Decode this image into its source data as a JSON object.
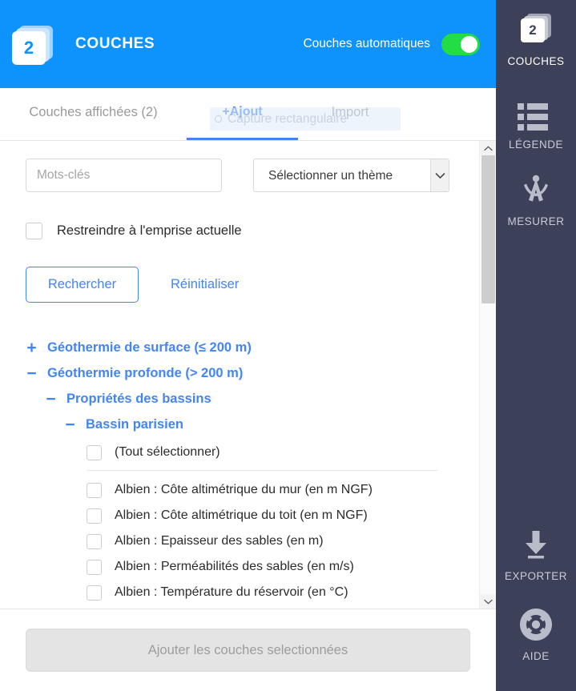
{
  "header": {
    "badge_count": "2",
    "title": "COUCHES",
    "auto_layers_label": "Couches automatiques",
    "toggle_state": "on",
    "bg_color": "#0d93fb",
    "toggle_color": "#22dd44"
  },
  "tabs": [
    {
      "id": "displayed",
      "label": "Couches affichées (2)",
      "active": false
    },
    {
      "id": "add",
      "label": "+Ajout",
      "active": true
    },
    {
      "id": "import",
      "label": "Import",
      "active": false
    }
  ],
  "overlay": {
    "capture_label": "Capture rectangulaire"
  },
  "search": {
    "keywords_placeholder": "Mots-clés",
    "keywords_value": "",
    "theme_selected": "Sélectionner un thème",
    "theme_options": [
      "Sélectionner un thème"
    ],
    "restrict_label": "Restreindre à l'emprise actuelle",
    "restrict_checked": false,
    "search_button": "Rechercher",
    "reset_button": "Réinitialiser",
    "accent_color": "#4285f4"
  },
  "tree": [
    {
      "level": 1,
      "toggle": "+",
      "label": "Géothermie de surface (≤ 200 m)",
      "expanded": false
    },
    {
      "level": 1,
      "toggle": "−",
      "label": "Géothermie profonde (> 200 m)",
      "expanded": true
    },
    {
      "level": 2,
      "toggle": "−",
      "label": "Propriétés des bassins",
      "expanded": true
    },
    {
      "level": 3,
      "toggle": "−",
      "label": "Bassin parisien",
      "expanded": true
    }
  ],
  "leaves": {
    "select_all_label": "(Tout sélectionner)",
    "items": [
      {
        "label": "Albien : Côte altimétrique du mur (en m NGF)",
        "checked": false
      },
      {
        "label": "Albien : Côte altimétrique du toit (en m NGF)",
        "checked": false
      },
      {
        "label": "Albien : Epaisseur des sables (en m)",
        "checked": false
      },
      {
        "label": "Albien : Perméabilités des sables (en m/s)",
        "checked": false
      },
      {
        "label": "Albien : Température du réservoir (en °C)",
        "checked": false
      }
    ]
  },
  "footer": {
    "add_button": "Ajouter les couches selectionnées",
    "add_button_disabled": true
  },
  "rail": {
    "bg_color": "#3c4159",
    "items": [
      {
        "id": "couches",
        "label": "COUCHES",
        "icon": "layers-icon",
        "badge": "2",
        "active": true
      },
      {
        "id": "legende",
        "label": "LÉGENDE",
        "icon": "legend-icon",
        "active": false
      },
      {
        "id": "mesurer",
        "label": "MESURER",
        "icon": "compass-icon",
        "active": false
      },
      {
        "id": "exporter",
        "label": "EXPORTER",
        "icon": "download-icon",
        "active": false
      },
      {
        "id": "aide",
        "label": "AIDE",
        "icon": "lifebuoy-icon",
        "active": false
      }
    ]
  }
}
